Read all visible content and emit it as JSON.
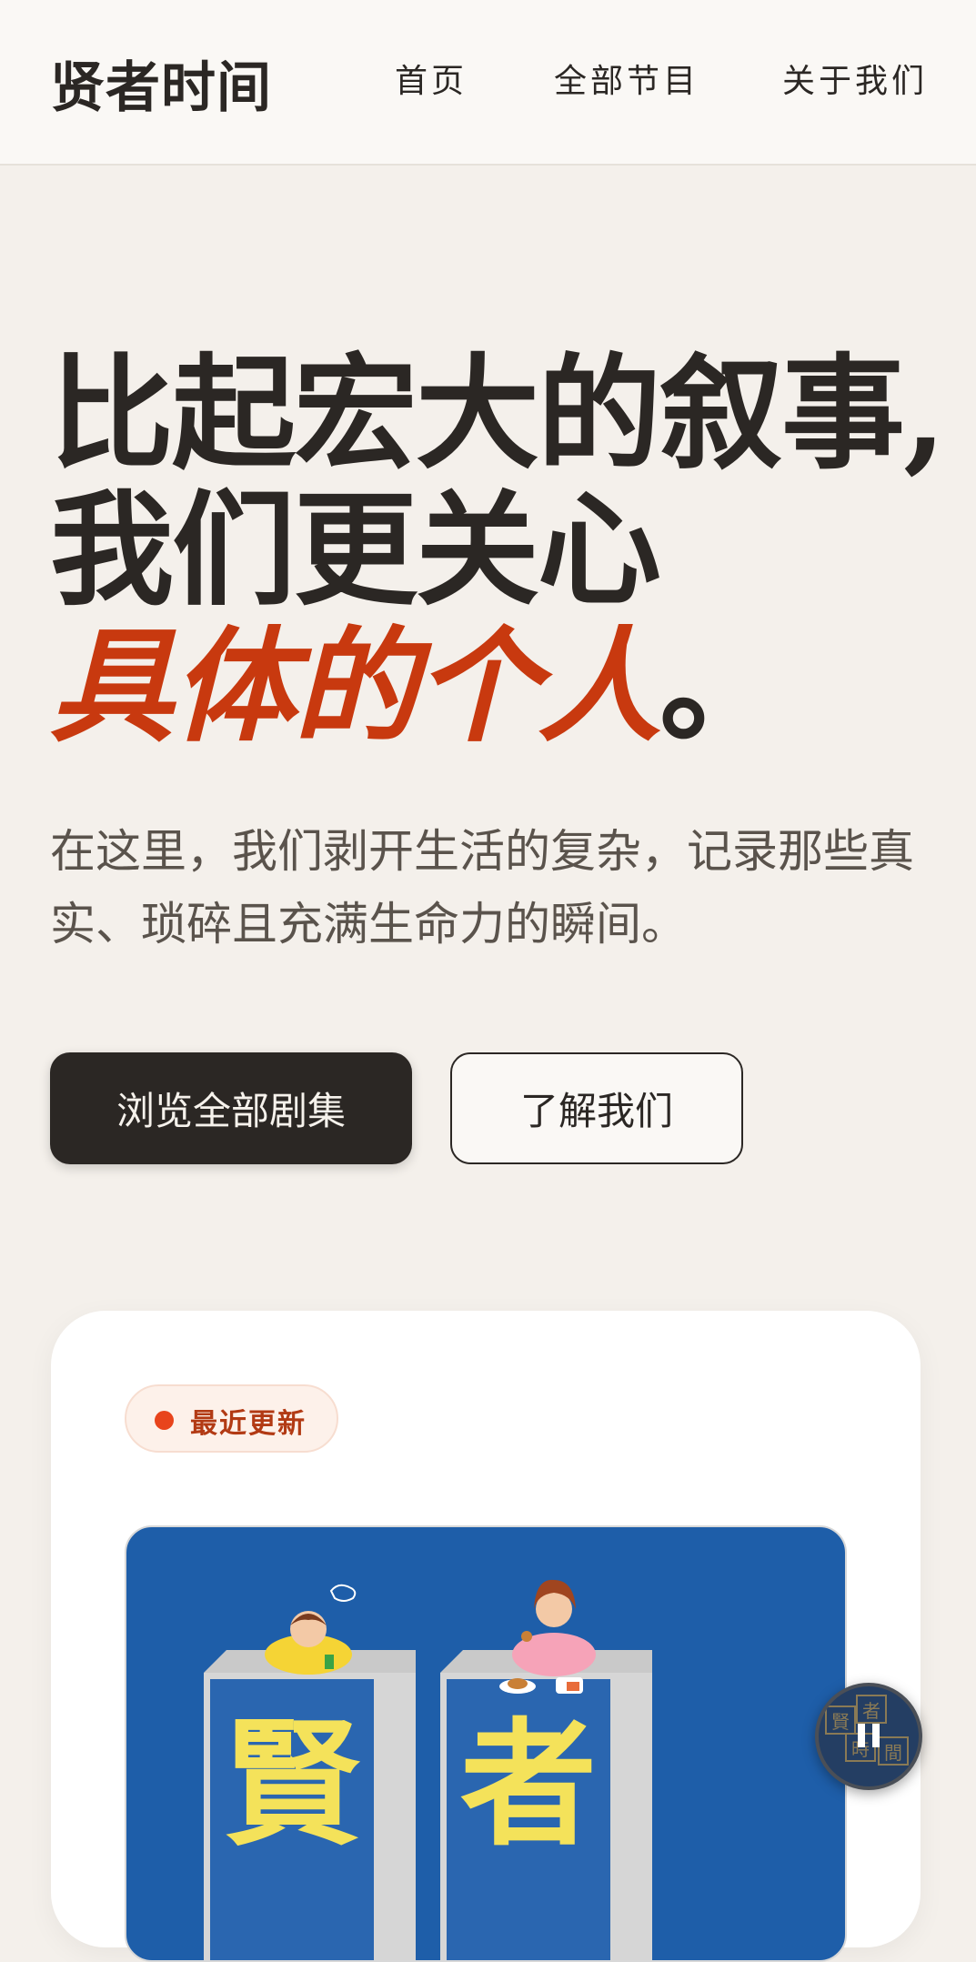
{
  "nav": {
    "logo": "贤者时间",
    "links": [
      "首页",
      "全部节目",
      "关于我们"
    ]
  },
  "hero": {
    "title_line1": "比起宏大的叙事,",
    "title_line2": "我们更关心",
    "title_accent": "具体的个人",
    "title_end": "。",
    "subtitle_line1": "在这里，我们剥开生活的复杂，记录那些真",
    "subtitle_line2": "实、琐碎且充满生命力的瞬间。",
    "primary_button": "浏览全部剧集",
    "secondary_button": "了解我们"
  },
  "latest": {
    "badge": "最近更新",
    "cover_chars": [
      "賢",
      "者"
    ],
    "player_seal_chars": [
      "賢",
      "者",
      "時",
      "間"
    ]
  },
  "colors": {
    "background": "#f4f0eb",
    "accent": "#c8390f",
    "dark": "#2b2724",
    "cover_blue": "#1e5ea9",
    "cover_yellow": "#f4e25a"
  },
  "icons": {
    "player": "pause-icon"
  }
}
